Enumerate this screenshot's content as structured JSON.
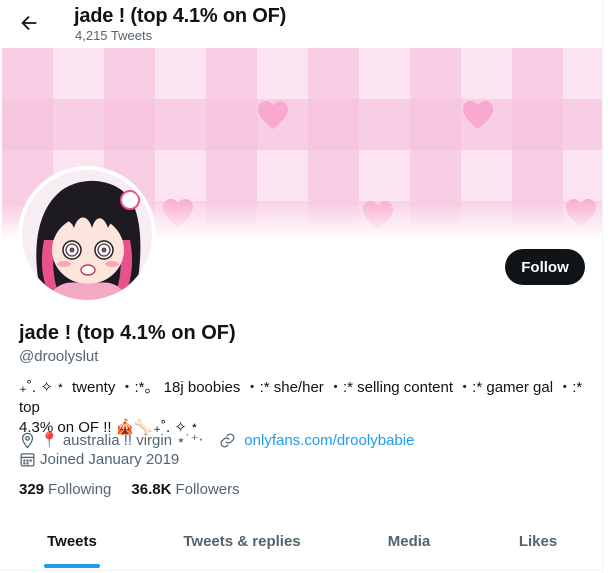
{
  "header": {
    "title": "jade ! (top 4.1% on OF)",
    "tweet_count": "4,215 Tweets"
  },
  "profile": {
    "name": "jade ! (top 4.1% on OF)",
    "handle": "@droolyslut",
    "bio_line1": "₊˚. ✧﹡ twenty ・:*。 18j boobies ・:* she/her ・:* selling content ・:* gamer gal ・:* top",
    "bio_line2": "4.3% on OF !! 🎪🦴₊˚. ✧﹡",
    "location": "📍 australia !! virgin ⋆˙⁺‧",
    "link": "onlyfans.com/droolybabie",
    "joined": "Joined January 2019",
    "following_count": "329",
    "following_label": "Following",
    "followers_count": "36.8K",
    "followers_label": "Followers",
    "follow_button": "Follow"
  },
  "tabs": [
    {
      "label": "Tweets",
      "active": true
    },
    {
      "label": "Tweets & replies",
      "active": false
    },
    {
      "label": "Media",
      "active": false
    },
    {
      "label": "Likes",
      "active": false
    }
  ],
  "icons": {
    "back": "arrow-left-icon",
    "location": "location-pin-icon",
    "link": "link-icon",
    "calendar": "calendar-icon"
  },
  "colors": {
    "accent": "#1d9bf0",
    "button_bg": "#0f1419",
    "secondary_text": "#536471",
    "banner_pink": "#fbe3f0",
    "heart_pink": "#f9a8cf"
  }
}
